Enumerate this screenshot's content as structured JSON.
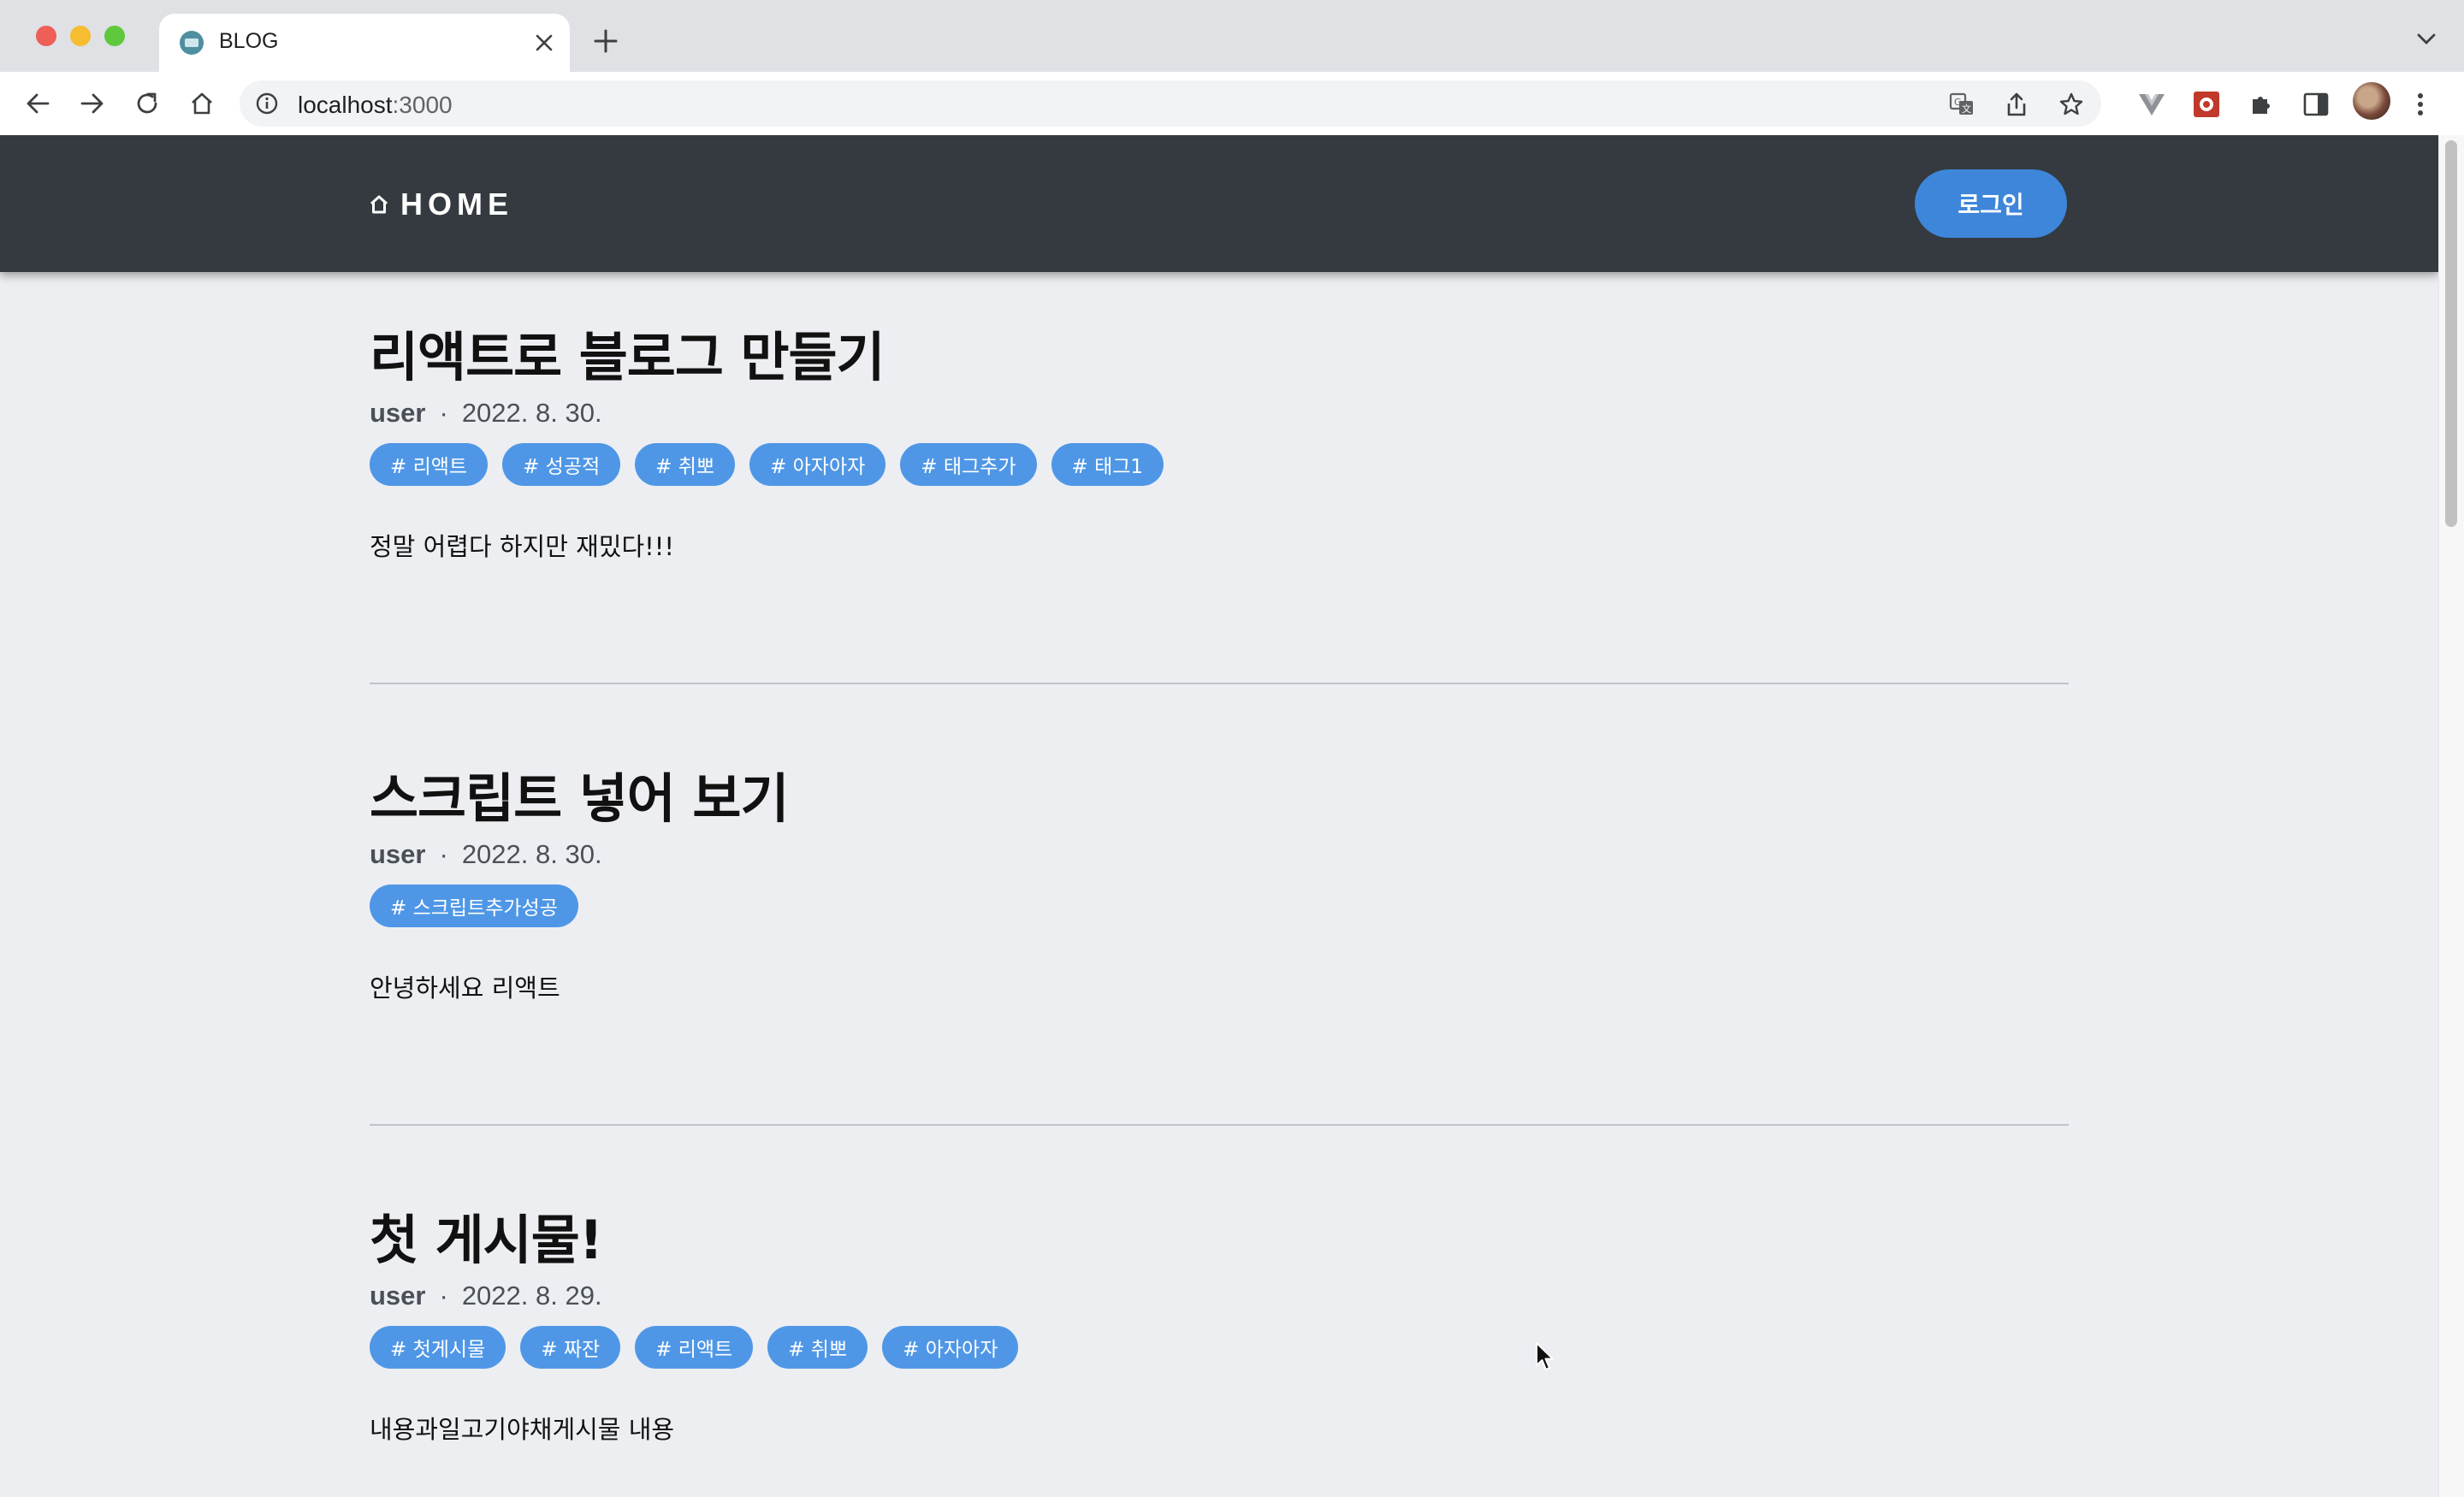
{
  "browser": {
    "tab_title": "BLOG",
    "url_host": "localhost",
    "url_port": ":3000"
  },
  "site": {
    "logo_label": "HOME",
    "login_label": "로그인"
  },
  "posts": [
    {
      "title": "리액트로 블로그 만들기",
      "author": "user",
      "separator": "·",
      "date": "2022. 8. 30.",
      "tags": [
        "# 리액트",
        "# 성공적",
        "# 취뽀",
        "# 아자아자",
        "# 태그추가",
        "# 태그1"
      ],
      "body": "정말 어렵다 하지만 재밌다!!!"
    },
    {
      "title": "스크립트 넣어 보기",
      "author": "user",
      "separator": "·",
      "date": "2022. 8. 30.",
      "tags": [
        "# 스크립트추가성공"
      ],
      "body": "안녕하세요 리액트"
    },
    {
      "title": "첫 게시물!",
      "author": "user",
      "separator": "·",
      "date": "2022. 8. 29.",
      "tags": [
        "# 첫게시물",
        "# 짜잔",
        "# 리액트",
        "# 취뽀",
        "# 아자아자"
      ],
      "body": "내용과일고기야채게시물 내용"
    }
  ],
  "colors": {
    "header_bg": "#343a40",
    "accent": "#3d86d9",
    "tag_bg": "#4f97e6",
    "page_bg": "#edeef2"
  }
}
